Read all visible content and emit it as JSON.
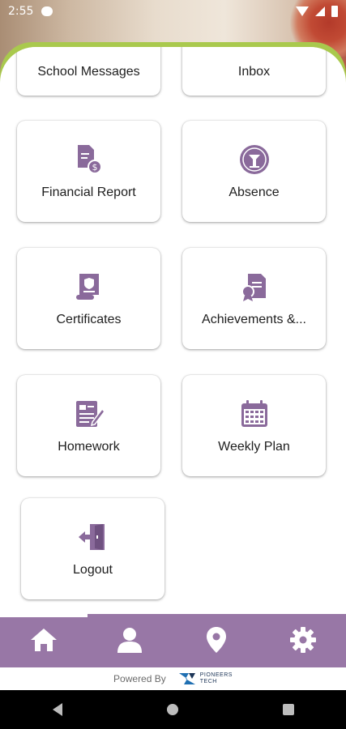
{
  "status_bar": {
    "time": "2:55",
    "icons": [
      "message-icon",
      "wifi-icon",
      "signal-icon",
      "battery-icon"
    ]
  },
  "menu": {
    "tiles": [
      {
        "id": "school-messages",
        "label": "School Messages",
        "icon": "message-icon"
      },
      {
        "id": "inbox",
        "label": "Inbox",
        "icon": "inbox-icon"
      },
      {
        "id": "financial-report",
        "label": "Financial Report",
        "icon": "invoice-dollar-icon"
      },
      {
        "id": "absence",
        "label": "Absence",
        "icon": "absence-icon"
      },
      {
        "id": "certificates",
        "label": "Certificates",
        "icon": "certificate-scroll-icon"
      },
      {
        "id": "achievements",
        "label": "Achievements &...",
        "icon": "award-document-icon"
      },
      {
        "id": "homework",
        "label": "Homework",
        "icon": "homework-icon"
      },
      {
        "id": "weekly-plan",
        "label": "Weekly Plan",
        "icon": "calendar-icon"
      },
      {
        "id": "logout",
        "label": "Logout",
        "icon": "logout-door-icon"
      }
    ]
  },
  "bottom_nav": {
    "items": [
      "home-icon",
      "profile-icon",
      "location-pin-icon",
      "settings-gear-icon"
    ]
  },
  "footer": {
    "powered_by": "Powered By",
    "brand_line1": "PIONEERS",
    "brand_line2": "TECH"
  },
  "colors": {
    "accent_purple": "#8a6a9b",
    "nav_purple": "#9877a6",
    "green_band": "#a9c94d"
  }
}
